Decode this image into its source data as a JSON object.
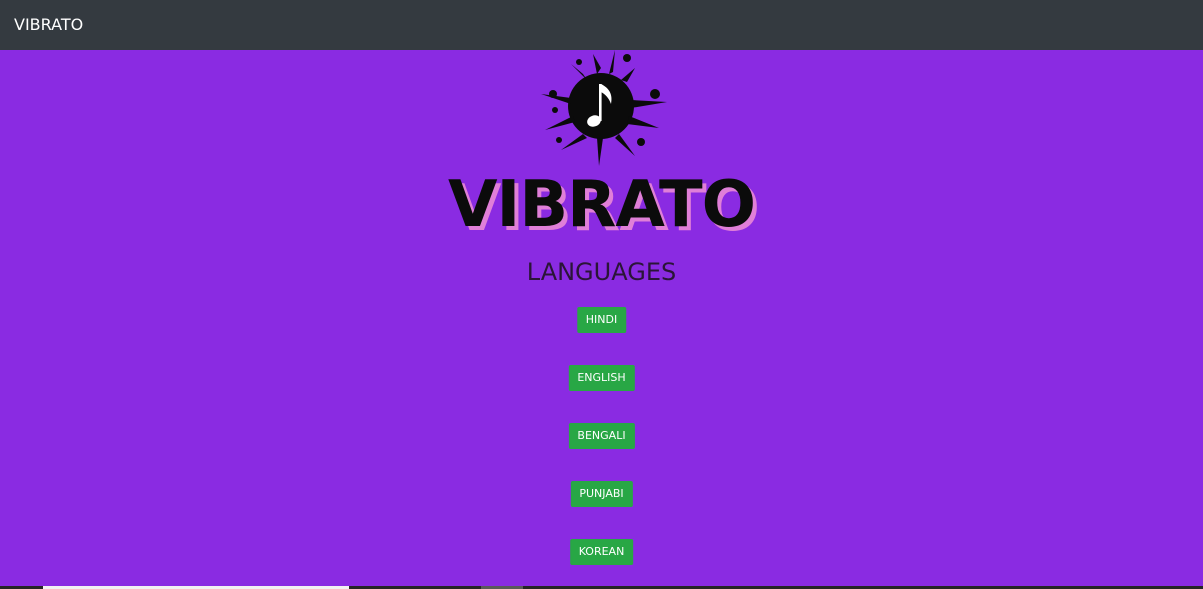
{
  "navbar": {
    "brand": "VIBRATO"
  },
  "hero": {
    "logo_icon": "music-note-splash-icon",
    "wordmark": "VIBRATO",
    "heading": "LANGUAGES"
  },
  "languages": [
    {
      "label": "HINDI"
    },
    {
      "label": "ENGLISH"
    },
    {
      "label": "BENGALI"
    },
    {
      "label": "PUNJABI"
    },
    {
      "label": "KOREAN"
    }
  ],
  "colors": {
    "background": "#8a2be2",
    "navbar": "#343a40",
    "button": "#28a745",
    "wordmark_shadow": "#e07fd8"
  }
}
